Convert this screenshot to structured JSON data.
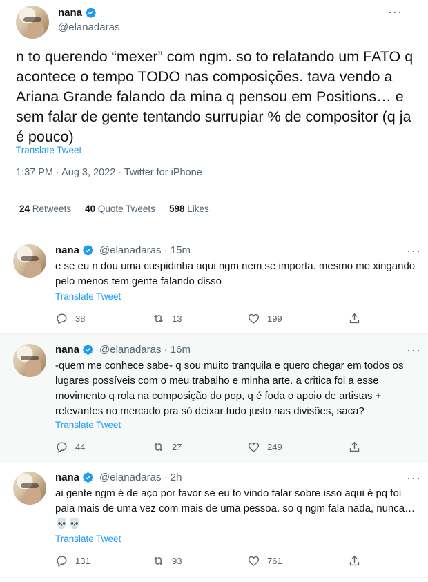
{
  "main": {
    "name": "nana",
    "handle": "@elanadaras",
    "text": "n to querendo “mexer” com ngm. so to relatando um FATO q acontece o tempo TODO nas composições. tava vendo a Ariana Grande falando da mina q pensou em Positions… e sem falar de gente tentando surrupiar % de compositor (q ja é pouco)",
    "translate": "Translate Tweet",
    "meta": "1:37 PM · Aug 3, 2022 · Twitter for iPhone",
    "retweets_count": "24",
    "retweets_label": "Retweets",
    "quotes_count": "40",
    "quotes_label": "Quote Tweets",
    "likes_count": "598",
    "likes_label": "Likes"
  },
  "replies": [
    {
      "name": "nana",
      "handle": "@elanadaras · 15m",
      "text": "e se eu n dou uma cuspidinha aqui ngm nem se importa. mesmo me xingando pelo menos tem gente falando disso",
      "translate": "Translate Tweet",
      "reply_count": "38",
      "retweet_count": "13",
      "like_count": "199"
    },
    {
      "name": "nana",
      "handle": "@elanadaras · 16m",
      "text": "-quem me conhece sabe- q sou muito tranquila e quero chegar em todos os lugares possíveis com o meu trabalho e minha arte. a critica foi a esse movimento q rola na composição do pop, q é foda o apoio de artistas + relevantes no mercado pra só deixar tudo justo nas divisões, saca?",
      "translate": "Translate Tweet",
      "reply_count": "44",
      "retweet_count": "27",
      "like_count": "249"
    },
    {
      "name": "nana",
      "handle": "@elanadaras · 2h",
      "text": "ai gente ngm é de aço por favor se eu to vindo falar sobre isso aqui é pq foi paia mais de uma vez com mais de uma pessoa. so q ngm fala nada, nunca… 💀💀",
      "translate": "Translate Tweet",
      "reply_count": "131",
      "retweet_count": "93",
      "like_count": "761"
    }
  ],
  "colors": {
    "accent": "#1d9bf0",
    "secondary_text": "#536471",
    "primary_text": "#0f1419"
  }
}
